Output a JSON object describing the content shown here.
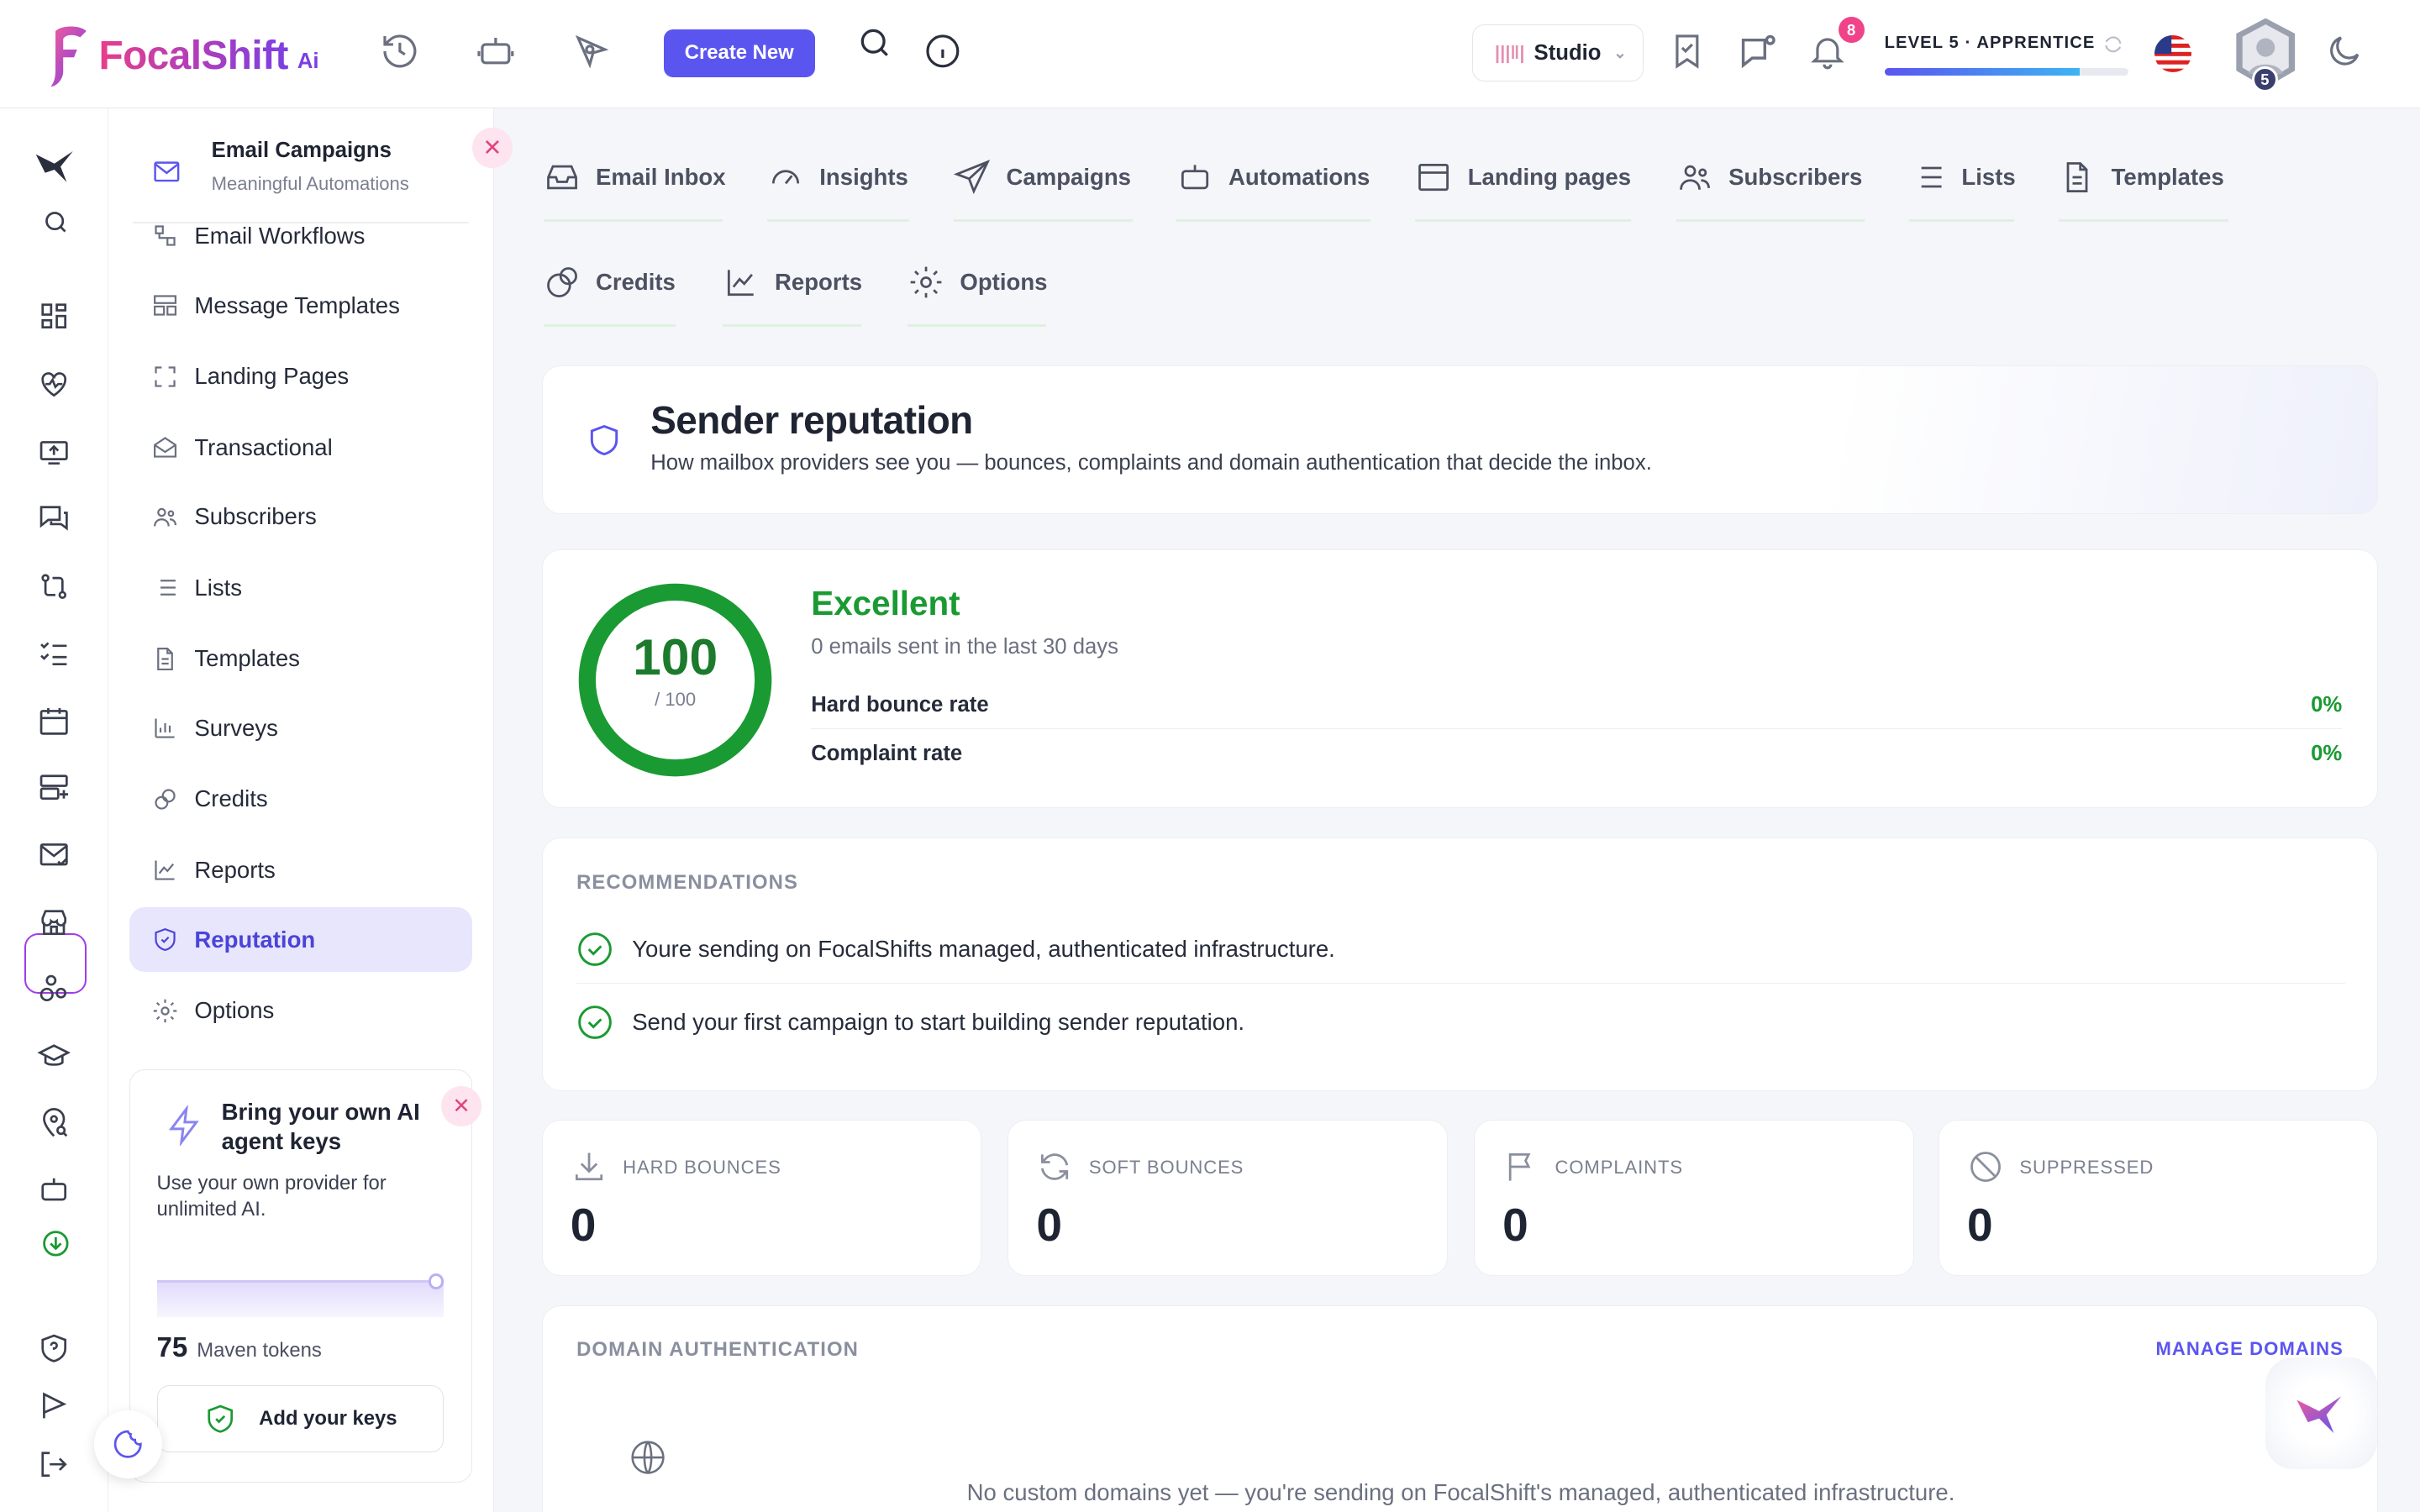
{
  "app": {
    "brand": "FocalShift",
    "brand_suffix": "Ai"
  },
  "topbar": {
    "create_label": "Create New",
    "studio_label": "Studio",
    "notif_count": "8",
    "level_label": "LEVEL 5 · APPRENTICE",
    "level_progress": 0.8,
    "avatar_level": "5"
  },
  "sidenav": {
    "title": "Email Campaigns",
    "subtitle": "Meaningful Automations",
    "items": [
      {
        "label": "Email Workflows",
        "icon": "workflow-icon"
      },
      {
        "label": "Message Templates",
        "icon": "layout-icon"
      },
      {
        "label": "Landing Pages",
        "icon": "frame-icon"
      },
      {
        "label": "Transactional",
        "icon": "mail-open-icon"
      },
      {
        "label": "Subscribers",
        "icon": "users-icon"
      },
      {
        "label": "Lists",
        "icon": "list-icon"
      },
      {
        "label": "Templates",
        "icon": "file-icon"
      },
      {
        "label": "Surveys",
        "icon": "bar-chart-icon"
      },
      {
        "label": "Credits",
        "icon": "coins-icon"
      },
      {
        "label": "Reports",
        "icon": "line-chart-icon"
      },
      {
        "label": "Reputation",
        "icon": "shield-icon",
        "active": true
      },
      {
        "label": "Options",
        "icon": "gear-icon"
      }
    ]
  },
  "byok": {
    "title": "Bring your own AI agent keys",
    "desc": "Use your own provider for unlimited AI.",
    "tokens": "75",
    "tokens_label": "Maven tokens",
    "button": "Add your keys"
  },
  "tabs": {
    "row1": [
      "Email Inbox",
      "Insights",
      "Campaigns",
      "Automations",
      "Landing pages",
      "Subscribers",
      "Lists",
      "Templates"
    ],
    "row2": [
      "Credits",
      "Reports",
      "Options"
    ]
  },
  "reputation": {
    "title": "Sender reputation",
    "subtitle": "How mailbox providers see you — bounces, complaints and domain authentication that decide the inbox."
  },
  "score": {
    "value": "100",
    "max": "/ 100",
    "fraction": 1.0,
    "label": "Excellent",
    "sent": "0 emails sent in the last 30 days",
    "metrics": [
      {
        "label": "Hard bounce rate",
        "value": "0%"
      },
      {
        "label": "Complaint rate",
        "value": "0%"
      }
    ]
  },
  "recommendations": {
    "caption": "RECOMMENDATIONS",
    "items": [
      "Youre sending on FocalShifts managed, authenticated infrastructure.",
      "Send your first campaign to start building sender reputation."
    ]
  },
  "stats": [
    {
      "label": "HARD BOUNCES",
      "value": "0",
      "icon": "download-icon"
    },
    {
      "label": "SOFT BOUNCES",
      "value": "0",
      "icon": "refresh-icon"
    },
    {
      "label": "COMPLAINTS",
      "value": "0",
      "icon": "flag-icon"
    },
    {
      "label": "SUPPRESSED",
      "value": "0",
      "icon": "ban-icon"
    }
  ],
  "domain": {
    "caption": "DOMAIN AUTHENTICATION",
    "manage": "MANAGE DOMAINS",
    "empty": "No custom domains yet — you're sending on FocalShift's managed, authenticated infrastructure."
  },
  "colors": {
    "accent": "#5b55f0",
    "good": "#1a9a32",
    "pink": "#f0438a"
  }
}
